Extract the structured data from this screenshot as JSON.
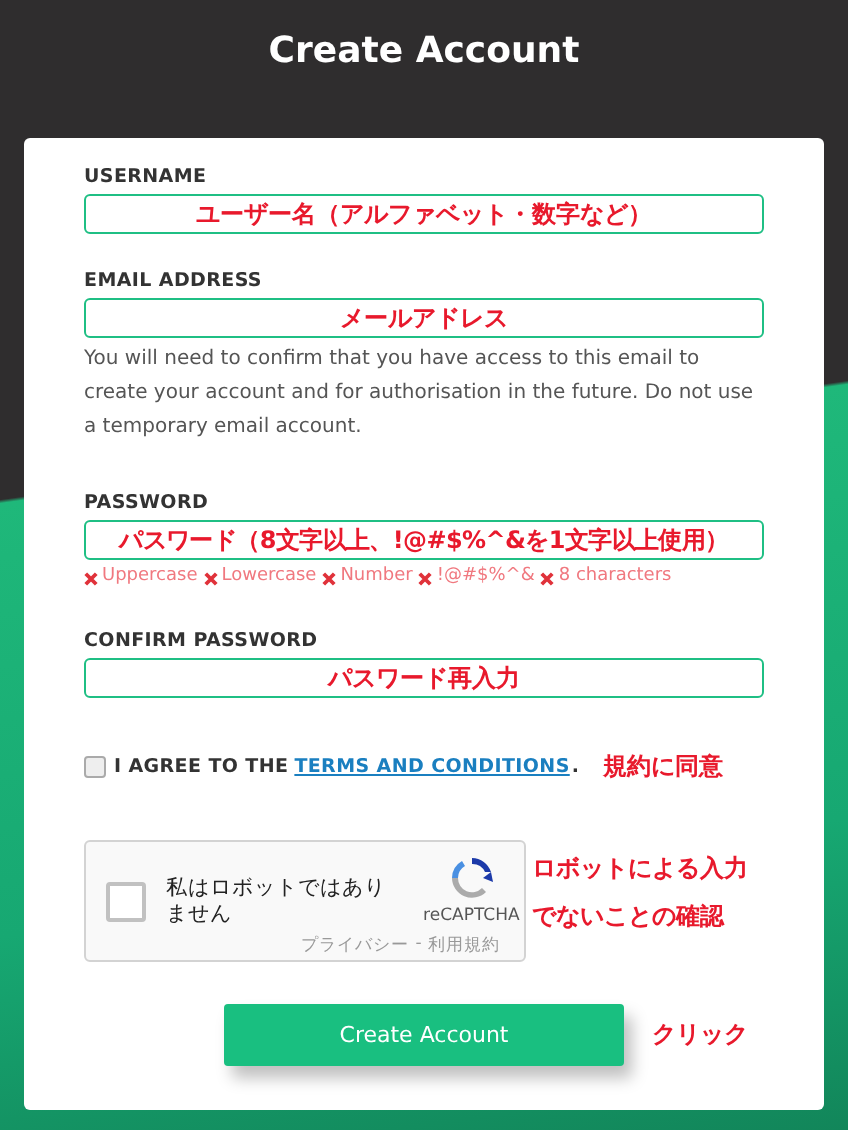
{
  "title": "Create Account",
  "fields": [
    {
      "label": "USERNAME",
      "annotation": "ユーザー名（アルファベット・数字など）"
    },
    {
      "label": "EMAIL ADDRESS",
      "annotation": "メールアドレス",
      "helper": "You will need to confirm that you have access to this email to create your account and for authorisation in the future. Do not use a temporary email account."
    },
    {
      "label": "PASSWORD",
      "annotation": "パスワード（8文字以上、!@#$%^&を1文字以上使用）",
      "hints": [
        {
          "label": "Uppercase",
          "met": false
        },
        {
          "label": "Lowercase",
          "met": false
        },
        {
          "label": "Number",
          "met": false
        },
        {
          "label": "!@#$%^&",
          "met": false
        },
        {
          "label": "8 characters",
          "met": false
        }
      ]
    },
    {
      "label": "CONFIRM PASSWORD",
      "annotation": "パスワード再入力"
    }
  ],
  "agree": {
    "checked": false,
    "prefix": "I AGREE TO THE",
    "link": "TERMS AND CONDITIONS",
    "suffix": ".",
    "annotation": "規約に同意"
  },
  "recaptcha": {
    "checked": false,
    "label": "私はロボットではありません",
    "brand": "reCAPTCHA",
    "privacy": "プライバシー",
    "separator": "-",
    "terms": "利用規約",
    "annotation": "ロボットによる入力でないことの確認"
  },
  "submit": {
    "label": "Create Account",
    "annotation": "クリック"
  }
}
